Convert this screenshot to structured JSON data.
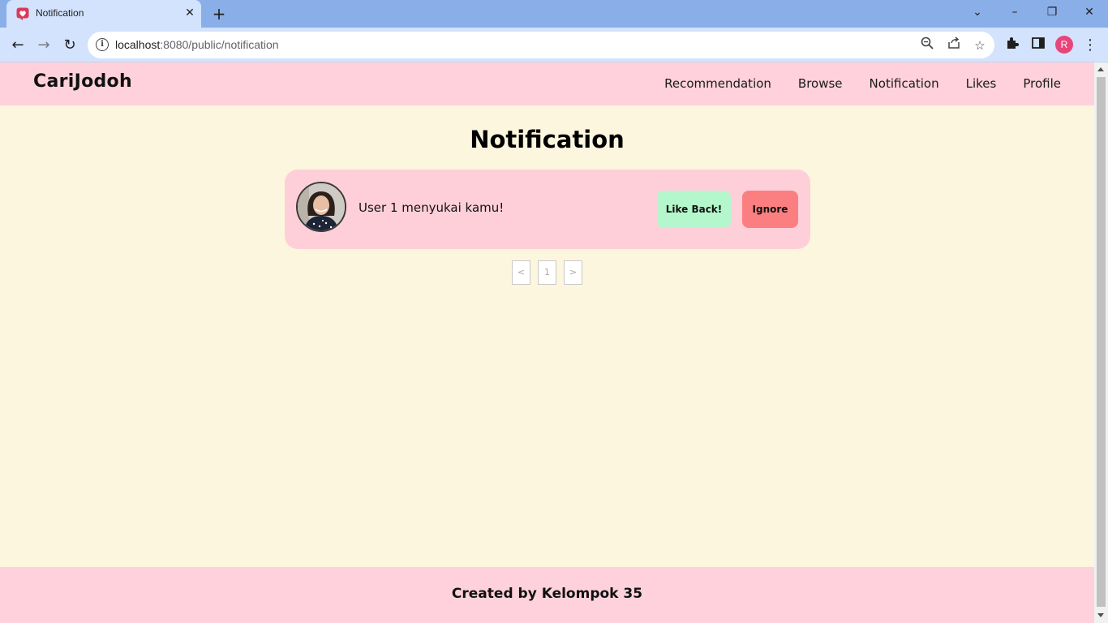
{
  "browser": {
    "tab_title": "Notification",
    "tab_close": "✕",
    "new_tab": "+",
    "url_host": "localhost",
    "url_path": ":8080/public/notification",
    "profile_initial": "R",
    "icons": [
      "heart-favicon-icon",
      "back-icon",
      "forward-icon",
      "reload-icon",
      "info-icon",
      "zoom-icon",
      "share-icon",
      "star-icon",
      "extensions-icon",
      "side-panel-icon",
      "menu-icon"
    ]
  },
  "site": {
    "logo": "CariJodoh",
    "nav": [
      "Recommendation",
      "Browse",
      "Notification",
      "Likes",
      "Profile"
    ],
    "heading": "Notification",
    "notification": {
      "message": "User 1 menyukai kamu!",
      "like_back_label": "Like Back!",
      "ignore_label": "Ignore"
    },
    "pagination": {
      "prev": "<",
      "current": "1",
      "next": ">"
    },
    "footer": "Created by Kelompok 35"
  },
  "colors": {
    "header_bg": "#ffd1dc",
    "page_bg": "#fbf6dd",
    "card_bg": "#ffcfd9",
    "like_button": "#b4f7cc",
    "ignore_button": "#fb7f80"
  }
}
